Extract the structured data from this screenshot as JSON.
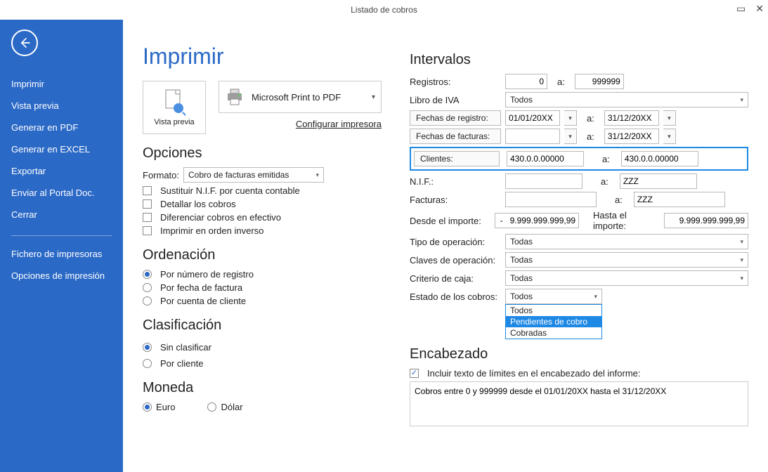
{
  "window": {
    "title": "Listado de cobros"
  },
  "sidebar": {
    "items": [
      "Imprimir",
      "Vista previa",
      "Generar en PDF",
      "Generar en EXCEL",
      "Exportar",
      "Enviar al Portal Doc.",
      "Cerrar"
    ],
    "secondary": [
      "Fichero de impresoras",
      "Opciones de impresión"
    ]
  },
  "page": {
    "title": "Imprimir",
    "vista_previa": "Vista previa",
    "printer": "Microsoft Print to PDF",
    "config_link": "Configurar impresora"
  },
  "opciones": {
    "heading": "Opciones",
    "formato_label": "Formato:",
    "formato_value": "Cobro de facturas emitidas",
    "checks": [
      "Sustituir N.I.F. por cuenta contable",
      "Detallar los cobros",
      "Diferenciar cobros en efectivo",
      "Imprimir en orden inverso"
    ]
  },
  "orden": {
    "heading": "Ordenación",
    "opts": [
      "Por número de registro",
      "Por fecha de factura",
      "Por cuenta de cliente"
    ]
  },
  "clasif": {
    "heading": "Clasificación",
    "opts": [
      "Sin clasificar",
      "Por cliente"
    ]
  },
  "moneda": {
    "heading": "Moneda",
    "opts": [
      "Euro",
      "Dólar"
    ]
  },
  "intervalos": {
    "heading": "Intervalos",
    "registros_l": "Registros:",
    "reg_from": "0",
    "reg_a": "a:",
    "reg_to": "999999",
    "libro_l": "Libro de IVA",
    "libro_v": "Todos",
    "fechas_reg_btn": "Fechas de registro:",
    "fechas_fac_btn": "Fechas de facturas:",
    "d1": "01/01/20XX",
    "d2": "31/12/20XX",
    "d3": "31/12/20XX",
    "clientes_btn": "Clientes:",
    "cli_from": "430.0.0.00000",
    "cli_to": "430.0.0.00000",
    "nif_l": "N.I.F.:",
    "nif_a": "a:",
    "nif_to": "ZZZ",
    "facturas_l": "Facturas:",
    "fac_a": "a:",
    "fac_to": "ZZZ",
    "desde_imp_l": "Desde el importe:",
    "desde_imp_v": "-   9.999.999.999,99",
    "hasta_imp_l": "Hasta el importe:",
    "hasta_imp_v": "9.999.999.999,99",
    "tipo_op_l": "Tipo de operación:",
    "tipo_op_v": "Todas",
    "claves_op_l": "Claves de operación:",
    "claves_op_v": "Todas",
    "crit_caja_l": "Criterio de caja:",
    "crit_caja_v": "Todas",
    "estado_l": "Estado de los cobros:",
    "estado_v": "Todos",
    "estado_opts": [
      "Todos",
      "Pendientes de cobro",
      "Cobradas"
    ]
  },
  "encabezado": {
    "heading": "Encabezado",
    "chk": "Incluir texto de límites en el encabezado del informe:",
    "text": "Cobros entre 0 y 999999 desde el 01/01/20XX hasta el 31/12/20XX"
  }
}
